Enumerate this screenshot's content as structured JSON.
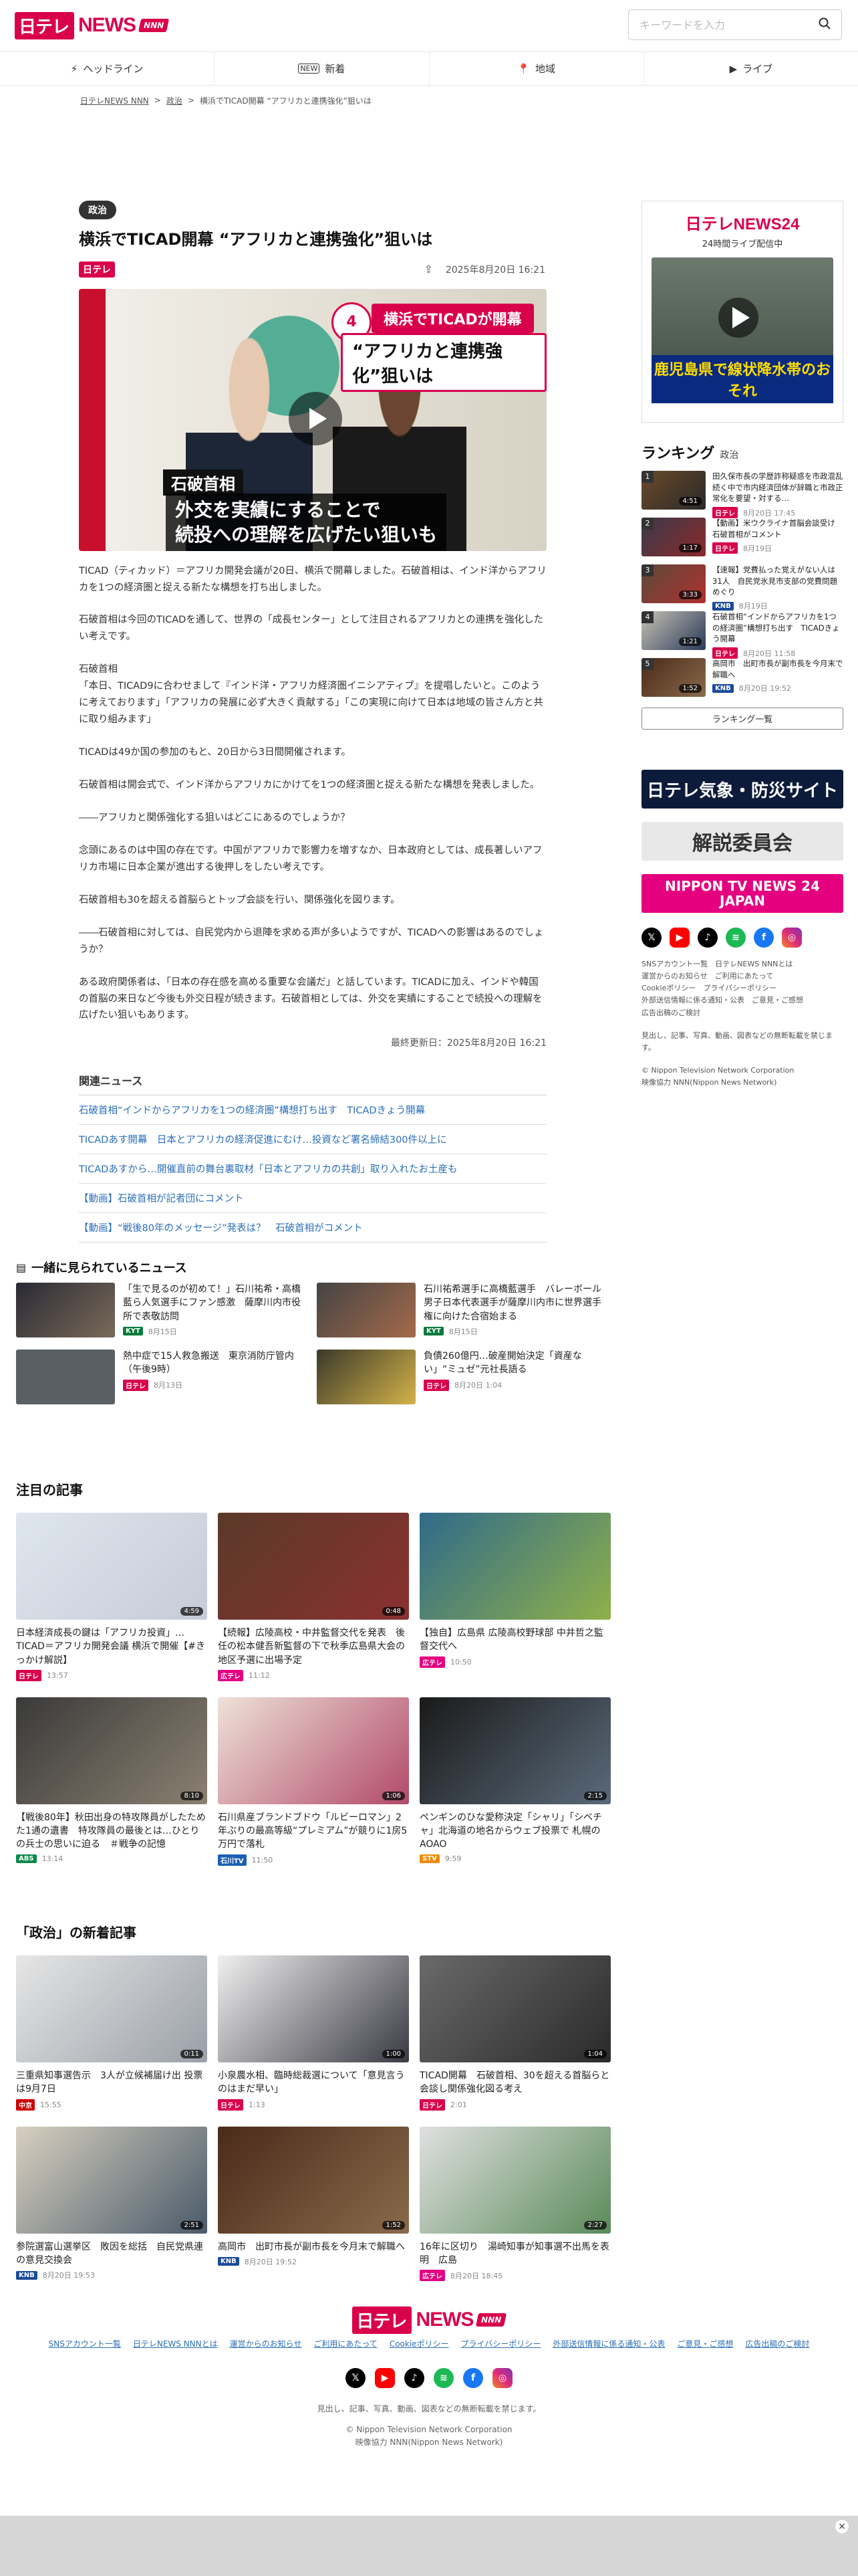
{
  "header": {
    "logo_ntv": "日テレ",
    "logo_news": "NEWS",
    "logo_nnn": "NNN",
    "search_placeholder": "キーワードを入力"
  },
  "nav": [
    "ヘッドライン",
    "新着",
    "地域",
    "ライブ"
  ],
  "breadcrumb": [
    "日テレNEWS NNN",
    "政治",
    "横浜でTICAD開幕 “アフリカと連携強化”狙いは"
  ],
  "article": {
    "category": "政治",
    "title": "横浜でTICAD開幕 “アフリカと連携強化”狙いは",
    "source": "日テレ",
    "date": "2025年8月20日 16:21",
    "hero": {
      "badge": "4",
      "top_line": "横浜でTICADが開幕",
      "sub_line": "“アフリカと連携強化”狙いは",
      "speaker": "石破首相",
      "caption_line1": "外交を実績にすることで",
      "caption_line2": "続投への理解を広げたい狙いも"
    },
    "paragraphs": [
      "TICAD（ティカッド）＝アフリカ開発会議が20日、横浜で開幕しました。石破首相は、インド洋からアフリカを1つの経済圏と捉える新たな構想を打ち出しました。",
      "石破首相は今回のTICADを通して、世界の「成長センター」として注目されるアフリカとの連携を強化したい考えです。",
      "石破首相\n「本日、TICAD9に合わせまして『インド洋・アフリカ経済圏イニシアティブ』を提唱したいと。このように考えております」「アフリカの発展に必ず大きく貢献する」「この実現に向けて日本は地域の皆さん方と共に取り組みます」",
      "TICADは49か国の参加のもと、20日から3日間開催されます。",
      "石破首相は開会式で、インド洋からアフリカにかけてを1つの経済圏と捉える新たな構想を発表しました。",
      "――アフリカと関係強化する狙いはどこにあるのでしょうか？",
      "念頭にあるのは中国の存在です。中国がアフリカで影響力を増すなか、日本政府としては、成長著しいアフリカ市場に日本企業が進出する後押しをしたい考えです。",
      "石破首相も30を超える首脳らとトップ会談を行い、関係強化を図ります。",
      "――石破首相に対しては、自民党内から退陣を求める声が多いようですが、TICADへの影響はあるのでしょうか？",
      "ある政府関係者は、「日本の存在感を高める重要な会議だ」と話しています。TICADに加え、インドや韓国の首脳の来日など今後も外交日程が続きます。石破首相としては、外交を実績にすることで続投への理解を広げたい狙いもあります。"
    ],
    "updated": "最終更新日：2025年8月20日 16:21"
  },
  "related": {
    "heading": "関連ニュース",
    "items": [
      "石破首相“インドからアフリカを1つの経済圏”構想打ち出す　TICADきょう開幕",
      "TICADあす開幕　日本とアフリカの経済促進にむけ…投資など署名締結300件以上に",
      "TICADあすから…開催直前の舞台裏取材「日本とアフリカの共創」取り入れたお土産も",
      "【動画】石破首相が記者団にコメント",
      "【動画】“戦後80年のメッセージ”発表は？　石破首相がコメント"
    ]
  },
  "also_viewed": {
    "heading": "一緒に見られているニュース",
    "items": [
      {
        "title": "「生で見るのが初めて！」石川祐希・高橋藍ら人気選手にファン感激　薩摩川内市役所で表敬訪問",
        "src": "KYT",
        "date": "8月15日"
      },
      {
        "title": "石川祐希選手に高橋藍選手　バレーボール男子日本代表選手が薩摩川内市に世界選手権に向けた合宿始まる",
        "src": "KYT",
        "date": "8月15日"
      },
      {
        "title": "熱中症で15人救急搬送　東京消防庁管内（午後9時）",
        "src": "日テレ",
        "date": "8月13日"
      },
      {
        "title": "負債260億円…破産開始決定「資産ない」“ミュゼ”元社長語る",
        "src": "日テレ",
        "date": "8月20日 1:04"
      }
    ]
  },
  "featured": {
    "heading": "注目の記事",
    "items": [
      {
        "title": "日本経済成長の鍵は「アフリカ投資」…TICAD＝アフリカ開発会議 横浜で開催【#きっかけ解説】",
        "src": "日テレ",
        "date": "13:57",
        "dur": "4:59"
      },
      {
        "title": "【続報】広陵高校・中井監督交代を発表　後任の松本健吾新監督の下で秋季広島県大会の地区予選に出場予定",
        "src": "広テレ",
        "date": "11:12",
        "dur": "0:48"
      },
      {
        "title": "【独自】広島県 広陵高校野球部 中井哲之監督交代へ",
        "src": "広テレ",
        "date": "10:50",
        "dur": ""
      },
      {
        "title": "【戦後80年】秋田出身の特攻隊員がしたためた1通の遺書　特攻隊員の最後とは…ひとりの兵士の思いに迫る　＃戦争の記憶",
        "src": "ABS",
        "date": "13:14",
        "dur": "8:10"
      },
      {
        "title": "石川県産ブランドブドウ「ルビーロマン」2年ぶりの最高等級“プレミアム”が競りに1房5万円で落札",
        "src": "石川TV",
        "date": "11:50",
        "dur": "1:06"
      },
      {
        "title": "ペンギンのひな愛称決定「シャリ」「シベチャ」北海道の地名からウェブ投票で 札幌のAOAO",
        "src": "STV",
        "date": "9:59",
        "dur": "2:15"
      }
    ]
  },
  "politics": {
    "heading": "「政治」の新着記事",
    "items": [
      {
        "title": "三重県知事選告示　3人が立候補届け出 投票は9月7日",
        "src": "中京",
        "date": "15:55",
        "dur": "0:11"
      },
      {
        "title": "小泉農水相、臨時総裁選について「意見言うのはまだ早い」",
        "src": "日テレ",
        "date": "1:13",
        "dur": "1:00"
      },
      {
        "title": "TICAD開幕　石破首相、30を超える首脳らと会談し関係強化図る考え",
        "src": "日テレ",
        "date": "2:01",
        "dur": "1:04"
      },
      {
        "title": "参院選富山選挙区　敗因を総括　自民党県連の意見交換会",
        "src": "KNB",
        "date": "8月20日 19:53",
        "dur": "2:51"
      },
      {
        "title": "高岡市　出町市長が副市長を今月末で解職へ",
        "src": "KNB",
        "date": "8月20日 19:52",
        "dur": "1:52"
      },
      {
        "title": "16年に区切り　湯崎知事が知事選不出馬を表明　広島",
        "src": "広テレ",
        "date": "8月20日 18:45",
        "dur": "2:27"
      }
    ]
  },
  "sidebar": {
    "live_logo": "日テレNEWS24",
    "live_sub": "24時間ライブ配信中",
    "live_caption": "鹿児島県で線状降水帯のおそれ",
    "ranking_heading": "ランキング",
    "ranking_cat": "政治",
    "ranking": [
      {
        "title": "田久保市長の学歴詐称疑惑を市政混乱続く中で市内経済団体が辞職と市政正常化を要望・対する…",
        "src": "日テレ",
        "date": "8月20日 17:45",
        "dur": "4:51"
      },
      {
        "title": "【動画】米ウクライナ首脳会談受け　石破首相がコメント",
        "src": "日テレ",
        "date": "8月19日",
        "dur": "1:17"
      },
      {
        "title": "【速報】党費払った覚えがない人は31人　自民党氷見市支部の党費問題めぐり",
        "src": "KNB",
        "date": "8月19日",
        "dur": "3:33"
      },
      {
        "title": "石破首相“インドからアフリカを1つの経済圏”構想打ち出す　TICADきょう開幕",
        "src": "日テレ",
        "date": "8月20日 11:58",
        "dur": "1:21"
      },
      {
        "title": "高岡市　出町市長が副市長を今月末で解職へ",
        "src": "KNB",
        "date": "8月20日 19:52",
        "dur": "1:52"
      }
    ],
    "ranking_more": "ランキング一覧",
    "banners": [
      "日テレ気象・防災サイト",
      "解説委員会",
      "NIPPON TV NEWS 24 JAPAN"
    ],
    "links": "SNSアカウント一覧　日テレNEWS NNNとは\n運営からのお知らせ　ご利用にあたって\nCookieポリシー　プライバシーポリシー\n外部送信情報に係る通知・公表　ご意見・ご感想\n広告出稿のご検討",
    "notice": "見出し、記事、写真、動画、図表などの無断転載を禁じます。",
    "copyright": "© Nippon Television Network Corporation\n映像協力 NNN(Nippon News Network)"
  },
  "footer": {
    "links": [
      "SNSアカウント一覧",
      "日テレNEWS NNNとは",
      "運営からのお知らせ",
      "ご利用にあたって",
      "Cookieポリシー",
      "プライバシーポリシー",
      "外部送信情報に係る通知・公表",
      "ご意見・ご感想",
      "広告出稿のご検討"
    ],
    "notice": "見出し、記事、写真、動画、図表などの無断転載を禁じます。",
    "copyright1": "© Nippon Television Network Corporation",
    "copyright2": "映像協力 NNN(Nippon News Network)"
  },
  "colors": {
    "brand": "#d9004c",
    "link": "#2b6fb7"
  }
}
